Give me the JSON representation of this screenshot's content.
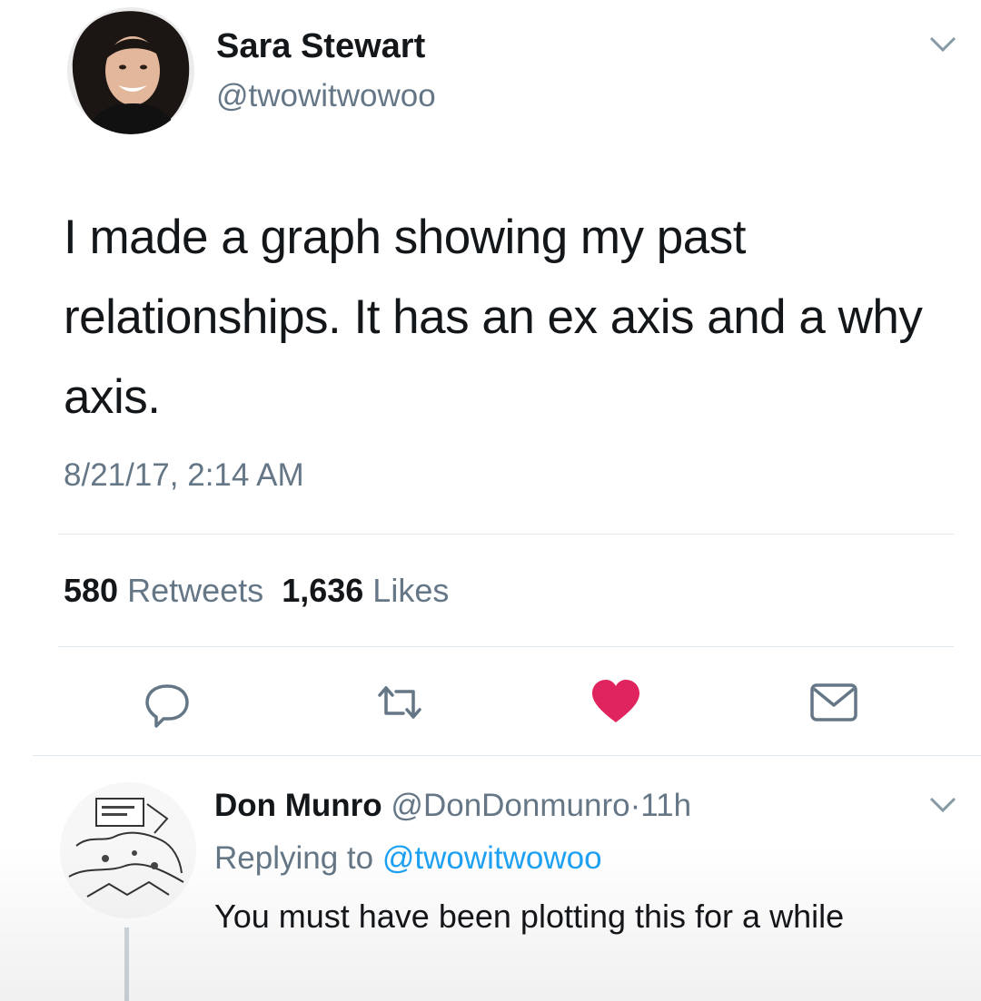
{
  "tweet": {
    "author_name": "Sara Stewart",
    "author_handle": "@twowitwowoo",
    "text": "I made a graph showing my past relationships. It has an ex axis and a why axis.",
    "timestamp": "8/21/17, 2:14 AM",
    "retweet_count": "580",
    "retweets_label": "Retweets",
    "like_count": "1,636",
    "likes_label": "Likes",
    "liked": true
  },
  "actions": [
    {
      "icon": "reply-icon"
    },
    {
      "icon": "retweet-icon"
    },
    {
      "icon": "heart-icon",
      "color": "#e0245e"
    },
    {
      "icon": "message-icon"
    }
  ],
  "reply": {
    "author_name": "Don Munro",
    "author_handle": "@DonDonmunro",
    "separator": "·",
    "time": "11h",
    "replying_prefix": "Replying to",
    "replying_handle": "@twowitwowoo",
    "text": "You must have been plotting this for a while"
  },
  "colors": {
    "text": "#14171a",
    "secondary": "#657786",
    "link": "#1da1f2",
    "like": "#e0245e",
    "divider": "#e1e8ed"
  }
}
